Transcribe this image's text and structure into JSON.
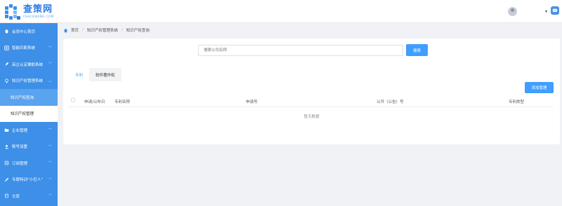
{
  "header": {
    "logo_title": "查策网",
    "logo_sub": "CHACEWANG.COM",
    "username": "",
    "caret": "▾"
  },
  "sidebar": {
    "items": [
      {
        "label": "会员中心首页",
        "icon": "home-icon",
        "arrow": ""
      },
      {
        "label": "智能匹配系统",
        "icon": "grid-icon",
        "arrow": "﹀"
      },
      {
        "label": "高企认定辅助系统",
        "icon": "rocket-icon",
        "arrow": "﹀"
      },
      {
        "label": "知识产权管理系统",
        "icon": "bulb-icon",
        "arrow": "︿"
      }
    ],
    "subitems": [
      {
        "label": "知识产权查询"
      },
      {
        "label": "知识产权管理"
      }
    ],
    "items2": [
      {
        "label": "企业管理",
        "icon": "folder-icon",
        "arrow": "﹀"
      },
      {
        "label": "账号设置",
        "icon": "user-settings-icon",
        "arrow": "﹀"
      },
      {
        "label": "订阅管理",
        "icon": "list-icon",
        "arrow": "﹀"
      },
      {
        "label": "专题特训“小巨人”",
        "icon": "wrench-icon",
        "arrow": "﹀"
      },
      {
        "label": "文库",
        "icon": "book-icon",
        "arrow": "﹀"
      }
    ]
  },
  "breadcrumb": {
    "home": "首页",
    "level2": "知识产权管理系统",
    "level3": "知识产权查询",
    "sep": "/"
  },
  "search": {
    "placeholder": "搜索公司名称",
    "button": "搜索"
  },
  "tabs": [
    {
      "label": "专利"
    },
    {
      "label": "软件著作权"
    }
  ],
  "add_button": "添加管理",
  "table": {
    "columns": [
      "申请/公布日",
      "专利名称",
      "申请号",
      "公开（公告）号",
      "专利类型"
    ],
    "empty_text": "暂无数据"
  },
  "colors": {
    "sidebar": "#3d8fe8",
    "primary": "#409eff"
  }
}
